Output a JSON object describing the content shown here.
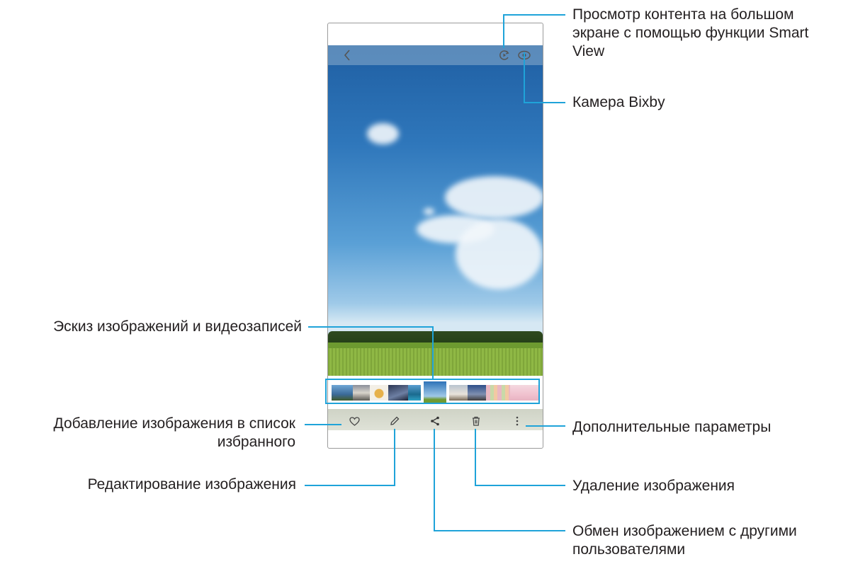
{
  "callouts": {
    "smart_view": "Просмотр контента на большом экране с помощью функции Smart View",
    "smart_view_lines": [
      "Просмотр контента на большом",
      "экране с помощью функции Smart",
      "View"
    ],
    "bixby": "Камера Bixby",
    "thumbnails": "Эскиз изображений и видеозаписей",
    "favorite_lines": [
      "Добавление изображения в список",
      "избранного"
    ],
    "more": "Дополнительные параметры",
    "edit": "Редактирование изображения",
    "delete": "Удаление изображения",
    "share_lines": [
      "Обмен изображением с другими",
      "пользователями"
    ]
  },
  "toolbar_icons": {
    "back": "chevron-left-icon",
    "smart_view": "smart-view-icon",
    "bixby": "eye-icon",
    "favorite": "heart-icon",
    "edit": "pencil-icon",
    "share": "share-icon",
    "delete": "trash-icon",
    "more": "more-vertical-icon"
  },
  "colors": {
    "accent": "#1fa3d9"
  }
}
